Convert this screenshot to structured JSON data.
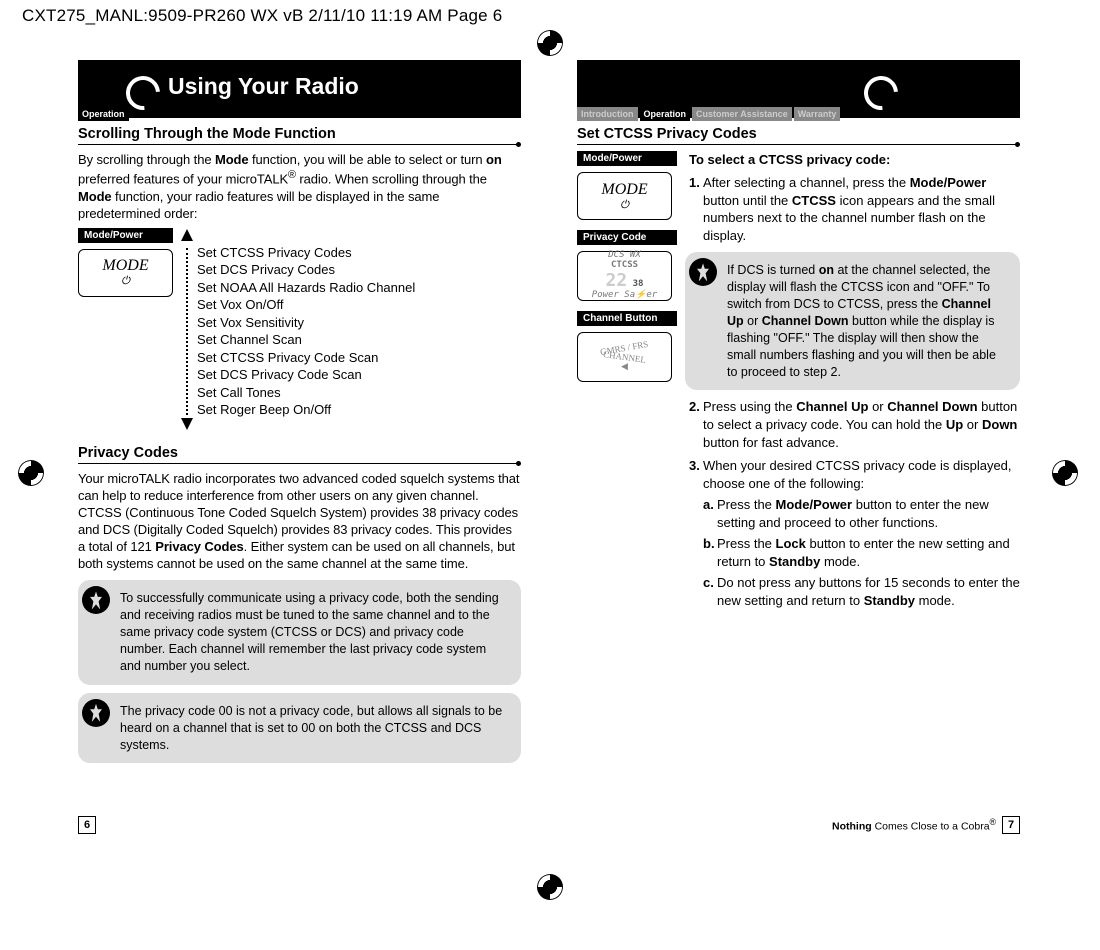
{
  "proof_header": "CXT275_MANL:9509-PR260 WX vB  2/11/10  11:19 AM  Page 6",
  "left": {
    "tab_operation": "Operation",
    "chapter_title": "Using Your Radio",
    "sec1_head": "Scrolling Through the Mode Function",
    "sec1_body": "By scrolling through the Mode function, you will be able to select or turn on preferred features of your microTALK® radio. When scrolling through the Mode function, your radio features will be displayed in the same predetermined order:",
    "illo_label_modepower": "Mode/Power",
    "mode_word": "MODE",
    "mode_list": [
      "Set CTCSS Privacy Codes",
      "Set DCS Privacy Codes",
      "Set NOAA All Hazards Radio Channel",
      "Set Vox On/Off",
      "Set Vox Sensitivity",
      "Set Channel Scan",
      "Set CTCSS Privacy Code Scan",
      "Set DCS Privacy Code Scan",
      "Set Call Tones",
      "Set Roger Beep On/Off"
    ],
    "sec2_head": "Privacy Codes",
    "sec2_body": "Your microTALK radio incorporates two advanced coded squelch systems that can help to reduce interference from other users on any given channel. CTCSS (Continuous Tone Coded Squelch System) provides 38 privacy codes and DCS (Digitally Coded Squelch) provides 83 privacy codes. This provides a total of 121 Privacy Codes. Either system can be used on all channels, but both systems cannot be used on the same channel at the same time.",
    "note1": "To successfully communicate using a privacy code, both the sending and receiving radios must be tuned to the same channel and to the same privacy code system (CTCSS or DCS) and privacy code number. Each channel will remember the last privacy code system and number you select.",
    "note2": "The privacy code 00 is not a privacy code, but allows all signals to be heard on a channel that is set to 00 on both the CTCSS and DCS systems.",
    "page_number": "6"
  },
  "right": {
    "tabs": {
      "intro": "Introduction",
      "operation": "Operation",
      "customer": "Customer Assistance",
      "warranty": "Warranty"
    },
    "sec_head": "Set CTCSS Privacy Codes",
    "illo_label_modepower": "Mode/Power",
    "illo_label_privacy": "Privacy Code",
    "illo_label_channel": "Channel Button",
    "mode_word": "MODE",
    "privacy_thumb": "DCS WX\nCTCSS\n22 38\nPower Saver",
    "channel_thumb": "GMRS / FRS  CHANNEL  ◀",
    "lead": "To select a CTCSS privacy code:",
    "step1": "After selecting a channel, press the Mode/Power button until the CTCSS icon appears and the small numbers next to the channel number flash on the display.",
    "note": "If DCS is turned on at the channel selected, the display will flash the CTCSS icon and \"OFF.\" To switch from DCS to CTCSS, press the Channel Up or Channel Down button while the display is flashing \"OFF.\" The display will then show the small numbers flashing and you will then be able to proceed to step 2.",
    "step2": "Press using the Channel Up or Channel Down button to select a privacy code. You can hold the Up or Down button for fast advance.",
    "step3_intro": "When your desired CTCSS privacy code is displayed, choose one of the following:",
    "step3a": "Press the Mode/Power button to enter the new setting and proceed to other functions.",
    "step3b": "Press the Lock button to enter the new setting and return to Standby mode.",
    "step3c": "Do not press any buttons for 15 seconds to enter the new setting and return to Standby mode.",
    "footer_tag": "Nothing Comes Close to a Cobra®",
    "page_number": "7"
  }
}
